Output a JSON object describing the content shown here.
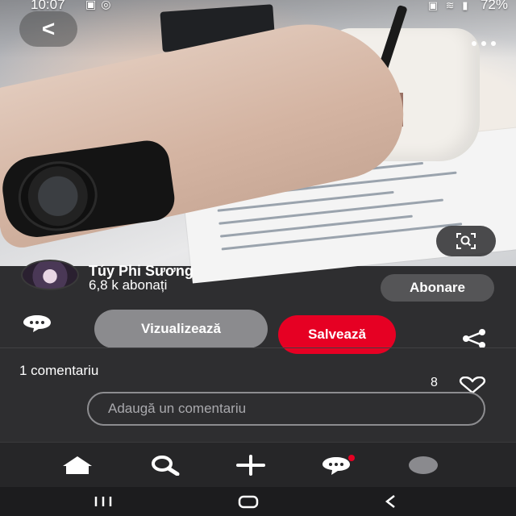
{
  "status_bar": {
    "time": "10:07",
    "battery": "72%",
    "notification_icons": [
      "image-icon",
      "whatsapp-icon"
    ],
    "system_icons": [
      "battery-saver-icon",
      "wifi-icon",
      "signal-icon"
    ]
  },
  "pin": {
    "image_description": "hand with black wristwatch holding a drink cup over printed paper"
  },
  "creator": {
    "name": "Túy Phi Sương",
    "followers": "6,8 k abonați",
    "follow_label": "Abonare"
  },
  "actions": {
    "visit_label": "Vizualizează",
    "save_label": "Salvează"
  },
  "comments": {
    "count_label": "1 comentariu",
    "likes": "8",
    "input_placeholder": "Adaugă un comentariu"
  },
  "tabs": [
    {
      "icon": "home-icon"
    },
    {
      "icon": "search-icon"
    },
    {
      "icon": "plus-icon"
    },
    {
      "icon": "chat-icon",
      "badge": true
    },
    {
      "icon": "profile-icon"
    }
  ],
  "colors": {
    "background": "#2e2e30",
    "save": "#e60023",
    "visit": "#8b8b8e",
    "follow": "#555557"
  }
}
